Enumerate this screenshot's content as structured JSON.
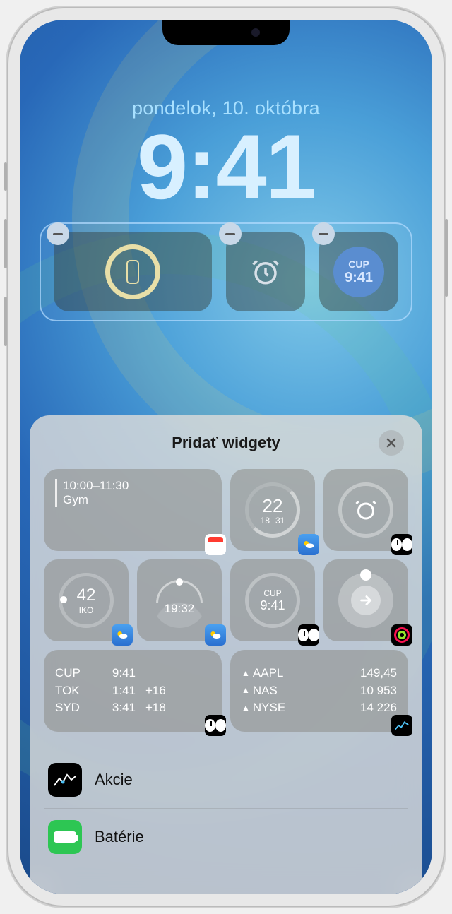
{
  "lockscreen": {
    "date": "pondelok, 10. októbra",
    "time": "9:41",
    "widgets": {
      "cup": {
        "label": "CUP",
        "time": "9:41"
      }
    }
  },
  "sheet": {
    "title": "Pridať widgety",
    "suggestions": {
      "calendar": {
        "time": "10:00–11:30",
        "title": "Gym"
      },
      "weather_temp": {
        "value": "22",
        "low": "18",
        "high": "31"
      },
      "aqi": {
        "value": "42",
        "label": "IKO"
      },
      "sunset": {
        "time": "19:32"
      },
      "world_clock_small": {
        "label": "CUP",
        "time": "9:41"
      },
      "world_clock_list": [
        {
          "city": "CUP",
          "time": "9:41",
          "offset": ""
        },
        {
          "city": "TOK",
          "time": "1:41",
          "offset": "+16"
        },
        {
          "city": "SYD",
          "time": "3:41",
          "offset": "+18"
        }
      ],
      "stocks": [
        {
          "symbol": "AAPL",
          "value": "149,45"
        },
        {
          "symbol": "NAS",
          "value": "10 953"
        },
        {
          "symbol": "NYSE",
          "value": "14 226"
        }
      ]
    },
    "apps": [
      {
        "name": "Akcie"
      },
      {
        "name": "Batérie"
      }
    ]
  }
}
